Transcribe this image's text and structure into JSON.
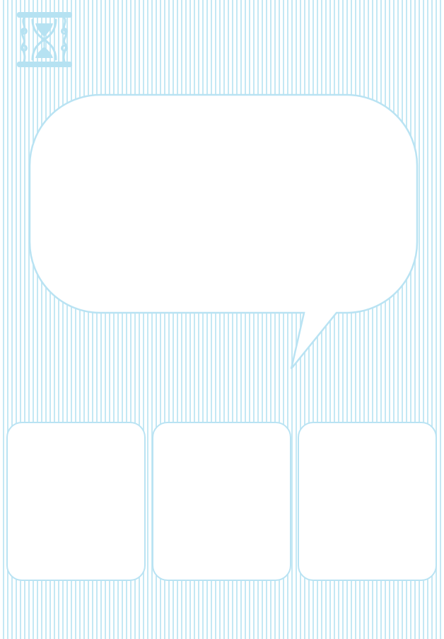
{
  "theme": {
    "stripe_color": "#c4e8f4",
    "outline_color": "#b9e3f3",
    "icon_color": "#b6e2f2",
    "panel_fill": "#ffffff"
  },
  "icons": {
    "top_left": "hourglass-icon"
  },
  "speech_bubble": {
    "text": ""
  },
  "cards": [
    {
      "text": ""
    },
    {
      "text": ""
    },
    {
      "text": ""
    }
  ]
}
